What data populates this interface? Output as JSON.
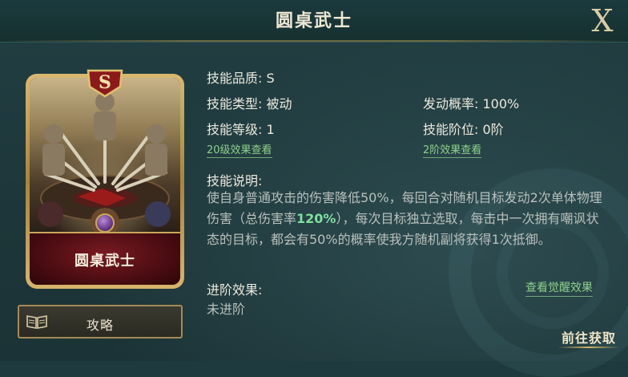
{
  "header": {
    "title": "圆桌武士",
    "close_label": "X"
  },
  "card": {
    "name": "圆桌武士",
    "grade": "S"
  },
  "strategy": {
    "label": "攻略"
  },
  "skill": {
    "quality": "技能品质: S",
    "type": "技能类型: 被动",
    "trigger_rate": "发动概率: 100%",
    "level": "技能等级: 1",
    "tier": "技能阶位: 0阶",
    "level_link": "20级效果查看",
    "tier_link": "2阶效果查看",
    "desc_title": "技能说明:",
    "desc_before": "使自身普通攻击的伤害降低50%，每回合对随机目标发动2次单体物理伤害（总伤害率",
    "desc_highlight": "120%",
    "desc_after": "），每次目标独立选取，每击中一次拥有嘲讽状态的目标，都会有50%的概率使我方随机副将获得1次抵御。",
    "advance_title": "进阶效果:",
    "advance_value": "未进阶",
    "awaken_link": "查看觉醒效果"
  },
  "footer": {
    "goto_label": "前往获取"
  },
  "colors": {
    "link": "#8ed08a",
    "highlight": "#7ee0a0",
    "frame_gold": "#c9a65a"
  }
}
